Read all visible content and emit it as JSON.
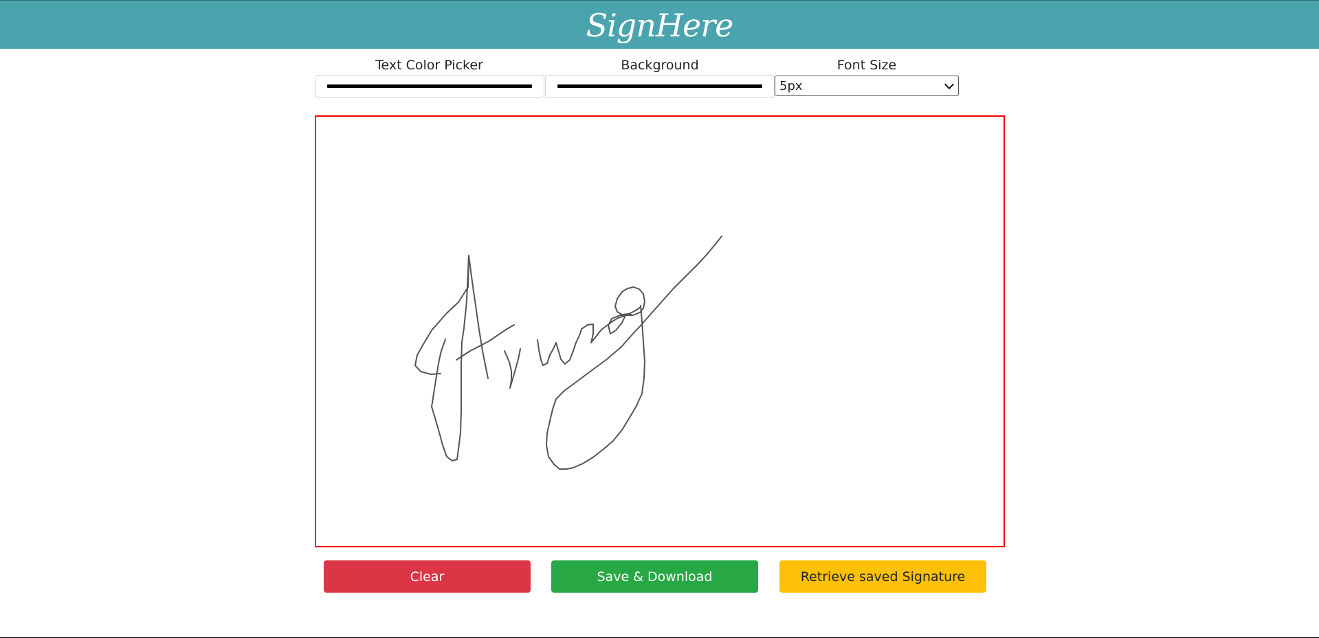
{
  "header": {
    "brand": "SignHere",
    "color": "#4aa3ad"
  },
  "controls": {
    "text_color_label": "Text Color Picker",
    "text_color_value": "#000000",
    "background_label": "Background",
    "background_value": "#000000",
    "font_size_label": "Font Size",
    "font_size_value": "5px"
  },
  "canvas": {
    "border_color": "#ff0000",
    "signature_color": "#555555"
  },
  "buttons": {
    "clear": "Clear",
    "save": "Save & Download",
    "retrieve": "Retrieve saved Signature"
  }
}
